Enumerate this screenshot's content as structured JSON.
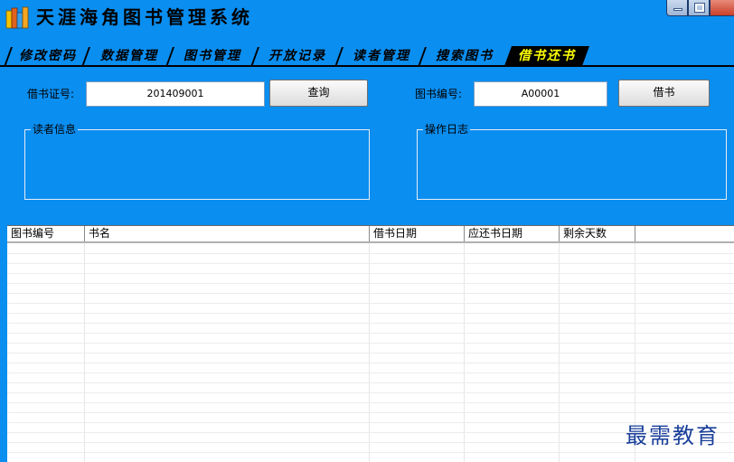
{
  "window": {
    "title": "天涯海角图书管理系统"
  },
  "tabs": [
    {
      "label": "修改密码",
      "active": false
    },
    {
      "label": "数据管理",
      "active": false
    },
    {
      "label": "图书管理",
      "active": false
    },
    {
      "label": "开放记录",
      "active": false
    },
    {
      "label": "读者管理",
      "active": false
    },
    {
      "label": "搜索图书",
      "active": false
    },
    {
      "label": "借书还书",
      "active": true
    }
  ],
  "form": {
    "card_label": "借书证号:",
    "card_value": "201409001",
    "query_button": "查询",
    "book_label": "图书编号:",
    "book_value": "A00001",
    "borrow_button": "借书"
  },
  "groups": {
    "reader_info": "读者信息",
    "operation_log": "操作日志"
  },
  "table": {
    "columns": [
      "图书编号",
      "书名",
      "借书日期",
      "应还书日期",
      "剩余天数"
    ],
    "rows": []
  },
  "watermark": "最需教育",
  "colors": {
    "background": "#0a8ef0",
    "active_tab_text": "#ffff00",
    "watermark": "#1a3f9a"
  }
}
